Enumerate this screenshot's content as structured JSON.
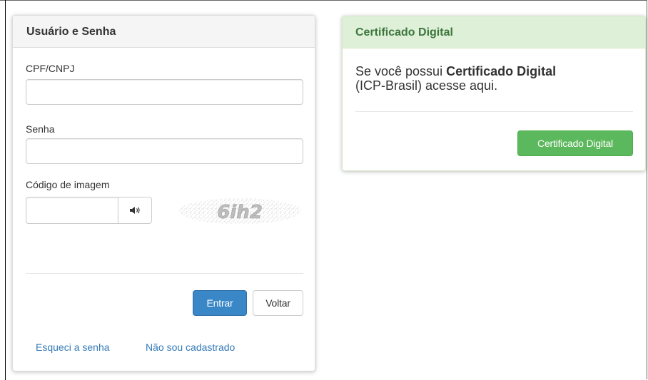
{
  "login_panel": {
    "title": "Usuário e Senha",
    "cpf_label": "CPF/CNPJ",
    "cpf_value": "",
    "password_label": "Senha",
    "password_value": "",
    "captcha_label": "Código de imagem",
    "captcha_value": "",
    "captcha_text": "6ih2",
    "audio_icon": "speaker-icon",
    "enter_button": "Entrar",
    "back_button": "Voltar",
    "forgot_link": "Esqueci a senha",
    "register_link": "Não sou cadastrado"
  },
  "cert_panel": {
    "title": "Certificado Digital",
    "text_prefix": "Se você possui ",
    "text_bold": "Certificado Digital",
    "text_suffix": "(ICP-Brasil) acesse aqui.",
    "button": "Certificado Digital"
  },
  "colors": {
    "primary": "#3a87c8",
    "success": "#5cb85c",
    "success_heading_bg": "#dff0d8",
    "success_heading_text": "#3c763d",
    "link": "#337ab7"
  }
}
